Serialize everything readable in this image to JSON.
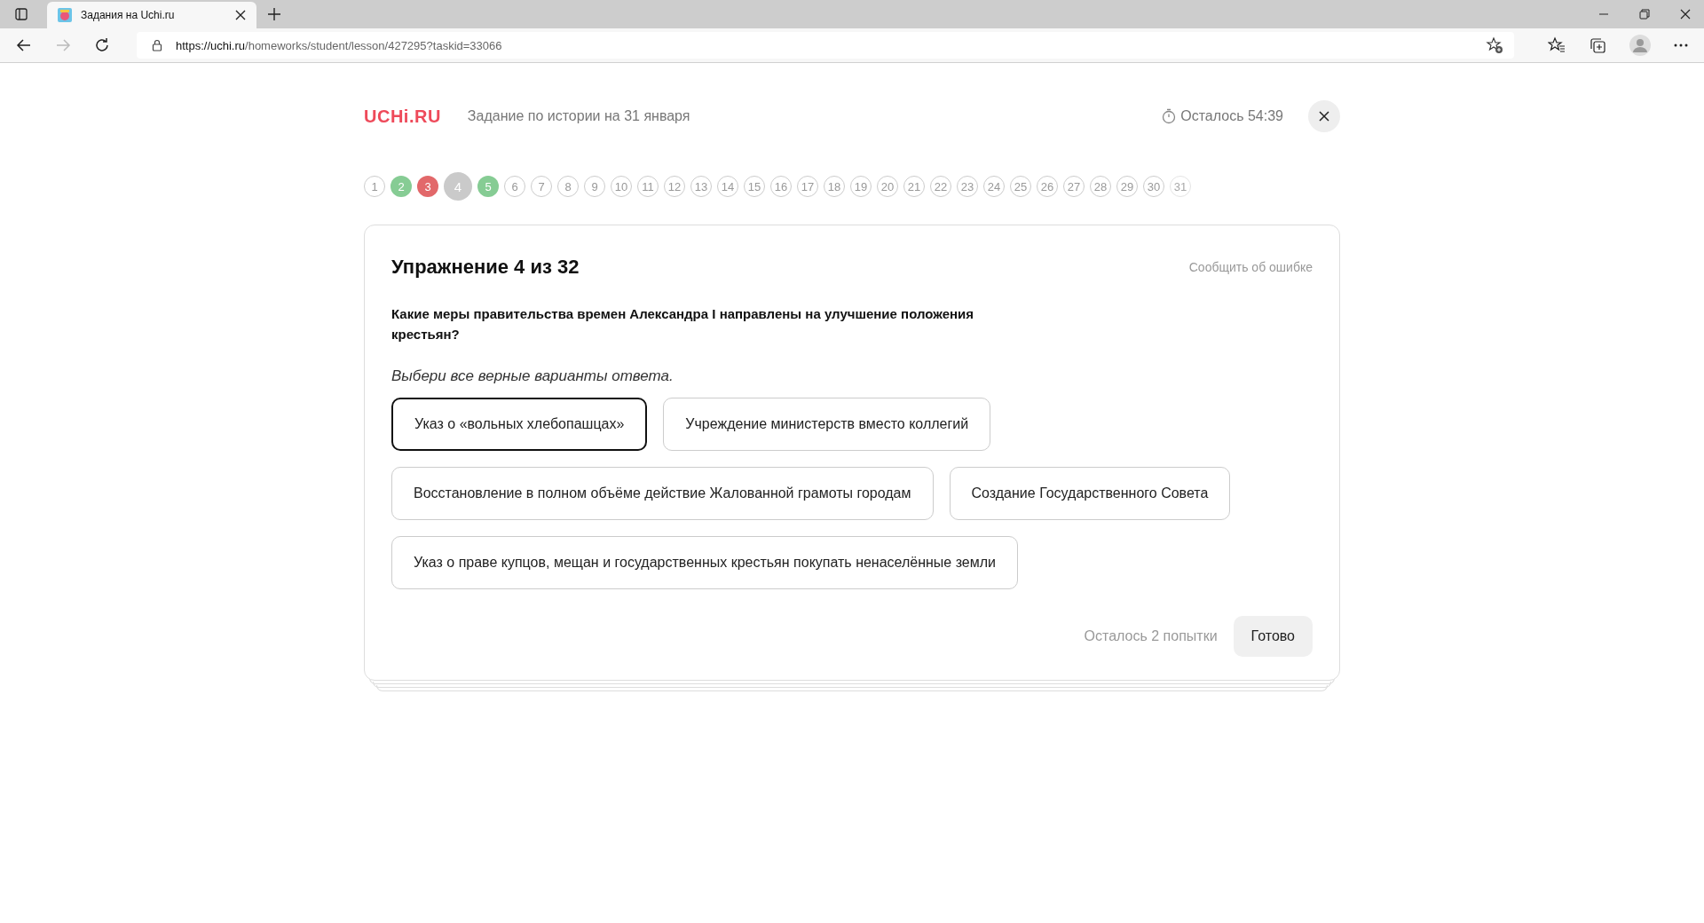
{
  "browser": {
    "tab_title": "Задания на Uchi.ru",
    "url_host": "https://uchi.ru",
    "url_path": "/homeworks/student/lesson/427295?taskid=33066"
  },
  "header": {
    "logo": "UCHi.RU",
    "title": "Задание по истории на 31 января",
    "timer": "Осталось 54:39"
  },
  "progress": [
    {
      "label": "1",
      "kind": "todo"
    },
    {
      "label": "2",
      "kind": "correct"
    },
    {
      "label": "3",
      "kind": "wrong"
    },
    {
      "label": "4",
      "kind": "current"
    },
    {
      "label": "5",
      "kind": "correct"
    },
    {
      "label": "6",
      "kind": "todo"
    },
    {
      "label": "7",
      "kind": "todo"
    },
    {
      "label": "8",
      "kind": "todo"
    },
    {
      "label": "9",
      "kind": "todo"
    },
    {
      "label": "10",
      "kind": "todo"
    },
    {
      "label": "11",
      "kind": "todo"
    },
    {
      "label": "12",
      "kind": "todo"
    },
    {
      "label": "13",
      "kind": "todo"
    },
    {
      "label": "14",
      "kind": "todo"
    },
    {
      "label": "15",
      "kind": "todo"
    },
    {
      "label": "16",
      "kind": "todo"
    },
    {
      "label": "17",
      "kind": "todo"
    },
    {
      "label": "18",
      "kind": "todo"
    },
    {
      "label": "19",
      "kind": "todo"
    },
    {
      "label": "20",
      "kind": "todo"
    },
    {
      "label": "21",
      "kind": "todo"
    },
    {
      "label": "22",
      "kind": "todo"
    },
    {
      "label": "23",
      "kind": "todo"
    },
    {
      "label": "24",
      "kind": "todo"
    },
    {
      "label": "25",
      "kind": "todo"
    },
    {
      "label": "26",
      "kind": "todo"
    },
    {
      "label": "27",
      "kind": "todo"
    },
    {
      "label": "28",
      "kind": "todo"
    },
    {
      "label": "29",
      "kind": "todo"
    },
    {
      "label": "30",
      "kind": "todo"
    },
    {
      "label": "31",
      "kind": "faded"
    }
  ],
  "exercise": {
    "title": "Упражнение 4 из 32",
    "report_link": "Сообщить об ошибке",
    "question": "Какие меры правительства времен Александра I направлены на улучшение положения крестьян?",
    "instruction": "Выбери все верные варианты ответа.",
    "options": [
      {
        "label": "Указ о «вольных хлебопашцах»",
        "selected": true
      },
      {
        "label": "Учреждение министерств вместо коллегий",
        "selected": false
      },
      {
        "label": "Восстановление в полном объёме действие Жалованной грамоты городам",
        "selected": false
      },
      {
        "label": "Создание Государственного Совета",
        "selected": false
      },
      {
        "label": "Указ о праве купцов, мещан и государственных крестьян покупать ненаселённые земли",
        "selected": false
      }
    ],
    "attempts": "Осталось 2 попытки",
    "submit": "Готово"
  }
}
